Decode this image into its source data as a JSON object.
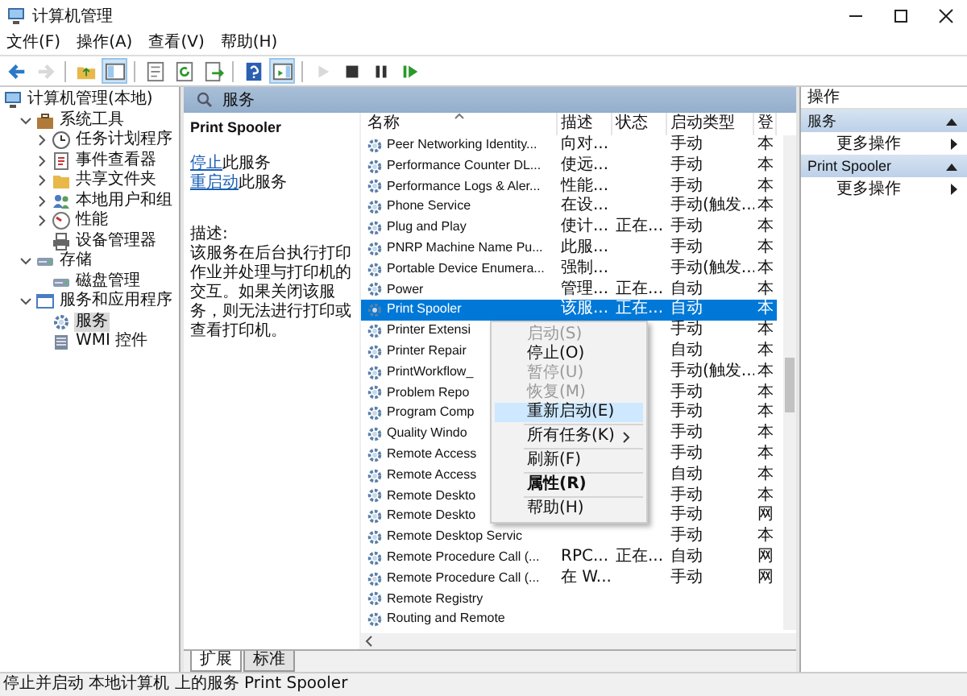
{
  "window": {
    "title": "计算机管理"
  },
  "menu": [
    "文件(F)",
    "操作(A)",
    "查看(V)",
    "帮助(H)"
  ],
  "toolbar": [
    {
      "kind": "back",
      "disabled": false,
      "on": false
    },
    {
      "kind": "forward",
      "disabled": true,
      "on": false
    },
    {
      "kind": "up",
      "disabled": false,
      "on": false
    },
    {
      "kind": "tree",
      "disabled": false,
      "on": true
    },
    {
      "kind": "properties",
      "disabled": false,
      "on": false
    },
    {
      "kind": "refresh",
      "disabled": false,
      "on": false
    },
    {
      "kind": "export",
      "disabled": false,
      "on": false
    },
    {
      "kind": "help",
      "disabled": false,
      "on": false
    },
    {
      "kind": "actions",
      "disabled": false,
      "on": true
    },
    {
      "kind": "start",
      "disabled": true,
      "on": false
    },
    {
      "kind": "stop",
      "disabled": false,
      "on": false
    },
    {
      "kind": "pause",
      "disabled": false,
      "on": false
    },
    {
      "kind": "restart",
      "disabled": false,
      "on": false
    }
  ],
  "tree": [
    {
      "label": "计算机管理(本地)",
      "selected": false,
      "children": [
        {
          "label": "系统工具",
          "expanded": true,
          "selected": false,
          "children": [
            {
              "label": "任务计划程序",
              "expanded": false,
              "selected": false
            },
            {
              "label": "事件查看器",
              "expanded": false,
              "selected": false
            },
            {
              "label": "共享文件夹",
              "expanded": false,
              "selected": false
            },
            {
              "label": "本地用户和组",
              "expanded": false,
              "selected": false
            },
            {
              "label": "性能",
              "expanded": false,
              "selected": false
            },
            {
              "label": "设备管理器",
              "selected": false
            }
          ]
        },
        {
          "label": "存储",
          "expanded": true,
          "selected": false,
          "children": [
            {
              "label": "磁盘管理",
              "selected": false
            }
          ]
        },
        {
          "label": "服务和应用程序",
          "expanded": true,
          "selected": false,
          "children": [
            {
              "label": "服务",
              "selected": true
            },
            {
              "label": "WMI 控件",
              "selected": false
            }
          ]
        }
      ]
    }
  ],
  "panel_header": "服务",
  "detail": {
    "title": "Print Spooler",
    "links": [
      {
        "link": "停止",
        "rest": "此服务"
      },
      {
        "link": "重启动",
        "rest": "此服务"
      }
    ],
    "description_label": "描述:",
    "description": "该服务在后台执行打印作业并处理与打印机的交互。如果关闭该服务，则无法进行打印或查看打印机。"
  },
  "table": {
    "columns": [
      "名称",
      "描述",
      "状态",
      "启动类型",
      "登"
    ],
    "rows": [
      {
        "name": "Peer Networking Identity...",
        "description": "向对...",
        "startup_type": "手动",
        "column_5": "本",
        "selected": false
      },
      {
        "name": "Performance Counter DL...",
        "description": "使远...",
        "startup_type": "手动",
        "column_5": "本",
        "selected": false
      },
      {
        "name": "Performance Logs & Aler...",
        "description": "性能...",
        "startup_type": "手动",
        "column_5": "本",
        "selected": false
      },
      {
        "name": "Phone Service",
        "description": "在设...",
        "startup_type": "手动(触发...",
        "column_5": "本",
        "selected": false
      },
      {
        "name": "Plug and Play",
        "description": "使计...",
        "status": "正在...",
        "startup_type": "手动",
        "column_5": "本",
        "selected": false
      },
      {
        "name": "PNRP Machine Name Pu...",
        "description": "此服...",
        "startup_type": "手动",
        "column_5": "本",
        "selected": false
      },
      {
        "name": "Portable Device Enumera...",
        "description": "强制...",
        "startup_type": "手动(触发...",
        "column_5": "本",
        "selected": false
      },
      {
        "name": "Power",
        "description": "管理...",
        "status": "正在...",
        "startup_type": "自动",
        "column_5": "本",
        "selected": false
      },
      {
        "name": "Print Spooler",
        "description": "该服...",
        "status": "正在...",
        "startup_type": "自动",
        "column_5": "本",
        "selected": true
      },
      {
        "name": "Printer Extensi",
        "startup_type": "手动",
        "column_5": "本",
        "selected": false
      },
      {
        "name": "Printer Repair",
        "startup_type": "自动",
        "column_5": "本",
        "selected": false
      },
      {
        "name": "PrintWorkflow_",
        "startup_type": "手动(触发...",
        "column_5": "本",
        "selected": false
      },
      {
        "name": "Problem Repo",
        "startup_type": "手动",
        "column_5": "本",
        "selected": false
      },
      {
        "name": "Program Comp",
        "startup_type": "手动",
        "column_5": "本",
        "selected": false
      },
      {
        "name": "Quality Windo",
        "startup_type": "手动",
        "column_5": "本",
        "selected": false
      },
      {
        "name": "Remote Access",
        "startup_type": "手动",
        "column_5": "本",
        "selected": false
      },
      {
        "name": "Remote Access",
        "startup_type": "自动",
        "column_5": "本",
        "selected": false
      },
      {
        "name": "Remote Deskto",
        "startup_type": "手动",
        "column_5": "本",
        "selected": false
      },
      {
        "name": "Remote Deskto",
        "startup_type": "手动",
        "column_5": "网",
        "selected": false
      },
      {
        "name": "Remote Desktop Servic",
        "startup_type": "手动",
        "column_5": "本",
        "selected": false
      },
      {
        "name": "Remote Procedure Call (...",
        "description": "RPC...",
        "status": "正在...",
        "startup_type": "自动",
        "column_5": "网",
        "selected": false
      },
      {
        "name": "Remote Procedure Call (...",
        "description": "在 W...",
        "startup_type": "手动",
        "column_5": "网",
        "selected": false
      },
      {
        "name": "Remote Registry",
        "selected": false
      },
      {
        "name": "Routing and Remote",
        "selected": false
      }
    ]
  },
  "context_menu": [
    {
      "kind": "item",
      "label": "启动(S)",
      "disabled": true,
      "selected": false,
      "default": false,
      "submenu": false
    },
    {
      "kind": "item",
      "label": "停止(O)",
      "disabled": false,
      "selected": false,
      "default": false,
      "submenu": false
    },
    {
      "kind": "item",
      "label": "暂停(U)",
      "disabled": true,
      "selected": false,
      "default": false,
      "submenu": false
    },
    {
      "kind": "item",
      "label": "恢复(M)",
      "disabled": true,
      "selected": false,
      "default": false,
      "submenu": false
    },
    {
      "kind": "item",
      "label": "重新启动(E)",
      "disabled": false,
      "selected": true,
      "default": false,
      "submenu": false
    },
    {
      "kind": "separator"
    },
    {
      "kind": "item",
      "label": "所有任务(K)",
      "disabled": false,
      "selected": false,
      "default": false,
      "submenu": true
    },
    {
      "kind": "separator"
    },
    {
      "kind": "item",
      "label": "刷新(F)",
      "disabled": false,
      "selected": false,
      "default": false,
      "submenu": false
    },
    {
      "kind": "separator"
    },
    {
      "kind": "item",
      "label": "属性(R)",
      "disabled": false,
      "selected": false,
      "default": true,
      "submenu": false
    },
    {
      "kind": "separator"
    },
    {
      "kind": "item",
      "label": "帮助(H)",
      "disabled": false,
      "selected": false,
      "default": false,
      "submenu": false
    }
  ],
  "actions": {
    "title": "操作",
    "sections": [
      {
        "title": "服务",
        "expanded": true,
        "items": [
          "更多操作"
        ]
      },
      {
        "title": "Print Spooler",
        "expanded": true,
        "items": [
          "更多操作"
        ]
      }
    ]
  },
  "tabs": [
    {
      "label": "扩展",
      "selected": true
    },
    {
      "label": "标准",
      "selected": false
    }
  ],
  "status_bar": "停止并启动 本地计算机 上的服务 Print Spooler"
}
